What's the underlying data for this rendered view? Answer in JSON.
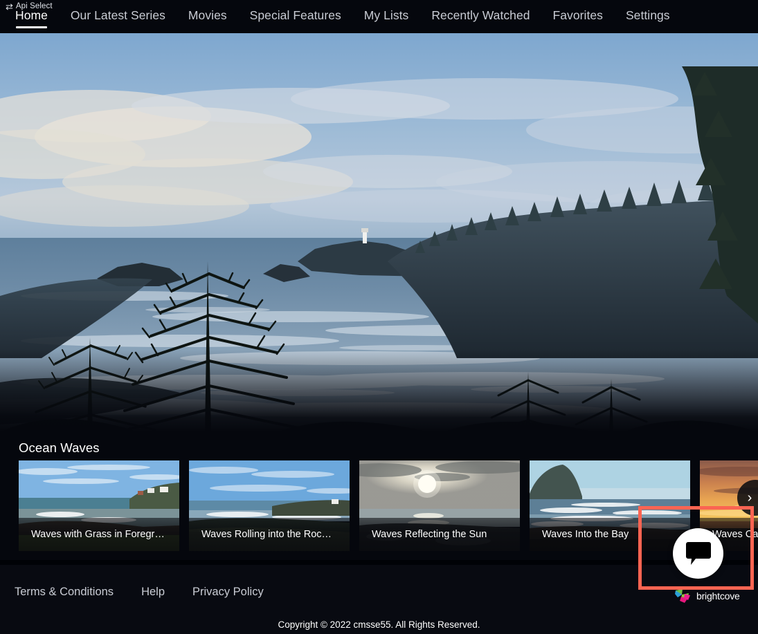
{
  "header": {
    "api_select": {
      "label": "Api Select",
      "icon": "swap-horizontal-icon",
      "glyph": "⇄"
    },
    "nav_items": [
      {
        "label": "Home",
        "active": true
      },
      {
        "label": "Our Latest Series",
        "active": false
      },
      {
        "label": "Movies",
        "active": false
      },
      {
        "label": "Special Features",
        "active": false
      },
      {
        "label": "My Lists",
        "active": false
      },
      {
        "label": "Recently Watched",
        "active": false
      },
      {
        "label": "Favorites",
        "active": false
      },
      {
        "label": "Settings",
        "active": false
      }
    ]
  },
  "hero": {
    "description": "Coastal sunset scene with silhouetted pine trees, ocean surf, forested headland and a lighthouse"
  },
  "carousel": {
    "title": "Ocean Waves",
    "next_arrow_glyph": "›",
    "cards": [
      {
        "title": "Waves with Grass in Foregr…",
        "scene": "rocky-shore-with-grass"
      },
      {
        "title": "Waves Rolling into the Roc…",
        "scene": "blue-sky-rocky-coast"
      },
      {
        "title": "Waves Reflecting the Sun",
        "scene": "sun-reflection-on-water"
      },
      {
        "title": "Waves Into the Bay",
        "scene": "bay-with-headland"
      },
      {
        "title": "Waves Ca",
        "scene": "orange-sunset-over-ocean"
      }
    ]
  },
  "footer": {
    "links": [
      {
        "label": "Terms & Conditions"
      },
      {
        "label": "Help"
      },
      {
        "label": "Privacy Policy"
      }
    ],
    "copyright": "Copyright © 2022 cmsse55. All Rights Reserved.",
    "brand": {
      "name": "brightcove",
      "mark": "brightcove-logo-icon"
    }
  },
  "chat_widget": {
    "icon": "chat-bubble-icon",
    "highlight_color": "#fb6452"
  },
  "colors": {
    "background": "#05070d",
    "footer_background": "#080a11",
    "text_primary": "#ffffff",
    "text_secondary": "#c9ccd4",
    "highlight": "#fb6452",
    "chat_button": "#ffffff"
  }
}
